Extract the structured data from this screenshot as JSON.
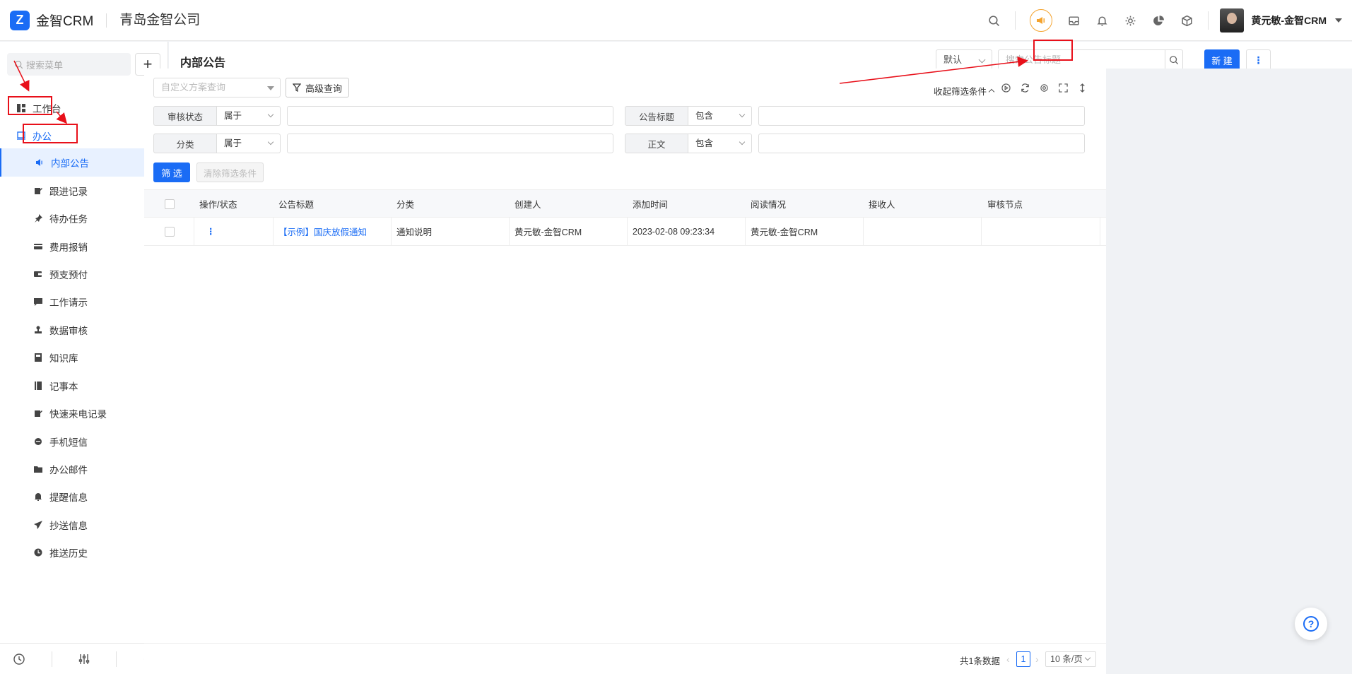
{
  "app": {
    "name": "金智CRM",
    "company": "青岛金智公司"
  },
  "user": {
    "name": "黄元敏-金智CRM"
  },
  "sidebar": {
    "search_placeholder": "搜索菜单",
    "add_label": "+",
    "items": [
      {
        "label": "工作台",
        "icon": "dashboard-icon"
      },
      {
        "label": "办公",
        "icon": "office-icon"
      },
      {
        "label": "内部公告",
        "icon": "megaphone-icon"
      },
      {
        "label": "跟进记录",
        "icon": "edit-icon"
      },
      {
        "label": "待办任务",
        "icon": "pin-icon"
      },
      {
        "label": "费用报销",
        "icon": "card-icon"
      },
      {
        "label": "预支预付",
        "icon": "wallet-icon"
      },
      {
        "label": "工作请示",
        "icon": "message-icon"
      },
      {
        "label": "数据审核",
        "icon": "stamp-icon"
      },
      {
        "label": "知识库",
        "icon": "book-icon"
      },
      {
        "label": "记事本",
        "icon": "notebook-icon"
      },
      {
        "label": "快速来电记录",
        "icon": "edit-icon"
      },
      {
        "label": "手机短信",
        "icon": "chat-icon"
      },
      {
        "label": "办公邮件",
        "icon": "folder-icon"
      },
      {
        "label": "提醒信息",
        "icon": "bell-icon"
      },
      {
        "label": "抄送信息",
        "icon": "send-icon"
      },
      {
        "label": "推送历史",
        "icon": "clock-icon"
      }
    ]
  },
  "header": {
    "title": "内部公告",
    "view_select": "默认",
    "search_placeholder": "搜索公告标题",
    "new_button": "新 建",
    "more_button": "⋮"
  },
  "filters": {
    "scheme_placeholder": "自定义方案查询",
    "advanced": "高级查询",
    "collapse": "收起筛选条件",
    "rows": [
      {
        "label": "审核状态",
        "op": "属于"
      },
      {
        "label": "公告标题",
        "op": "包含"
      },
      {
        "label": "分类",
        "op": "属于"
      },
      {
        "label": "正文",
        "op": "包含"
      }
    ],
    "filter_button": "筛 选",
    "clear_button": "清除筛选条件"
  },
  "table": {
    "columns": [
      "操作/状态",
      "公告标题",
      "分类",
      "创建人",
      "添加时间",
      "阅读情况",
      "接收人",
      "审核节点"
    ],
    "rows": [
      {
        "action": "⋮",
        "title": "【示例】国庆放假通知",
        "category": "通知说明",
        "creator": "黄元敏-金智CRM",
        "time": "2023-02-08 09:23:34",
        "read": "黄元敏-金智CRM",
        "receiver": "",
        "node": ""
      }
    ]
  },
  "pagination": {
    "total": "共1条数据",
    "page": "1",
    "page_size": "10 条/页"
  },
  "colors": {
    "primary": "#1a6cf5",
    "annotation": "#e8101a",
    "accent_orange": "#f4a32e"
  }
}
